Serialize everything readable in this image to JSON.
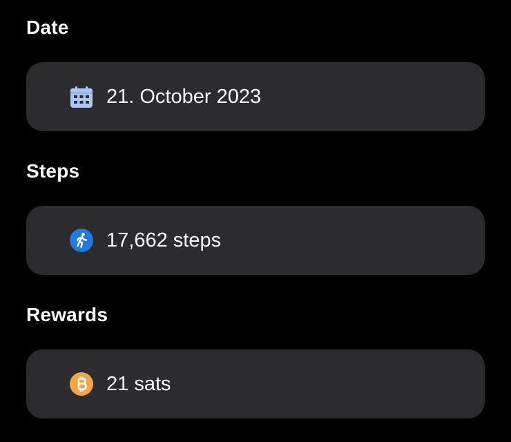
{
  "sections": {
    "date": {
      "title": "Date",
      "value": "21. October 2023",
      "icon": "calendar-icon",
      "icon_color": "#a9c8f5"
    },
    "steps": {
      "title": "Steps",
      "value": "17,662 steps",
      "icon": "running-person-icon",
      "icon_color": "#1f7ae0"
    },
    "rewards": {
      "title": "Rewards",
      "value": "21 sats",
      "icon": "bitcoin-icon",
      "icon_color": "#f5a446"
    }
  },
  "colors": {
    "background": "#000000",
    "card": "#2c2c2e",
    "text": "#ffffff"
  }
}
